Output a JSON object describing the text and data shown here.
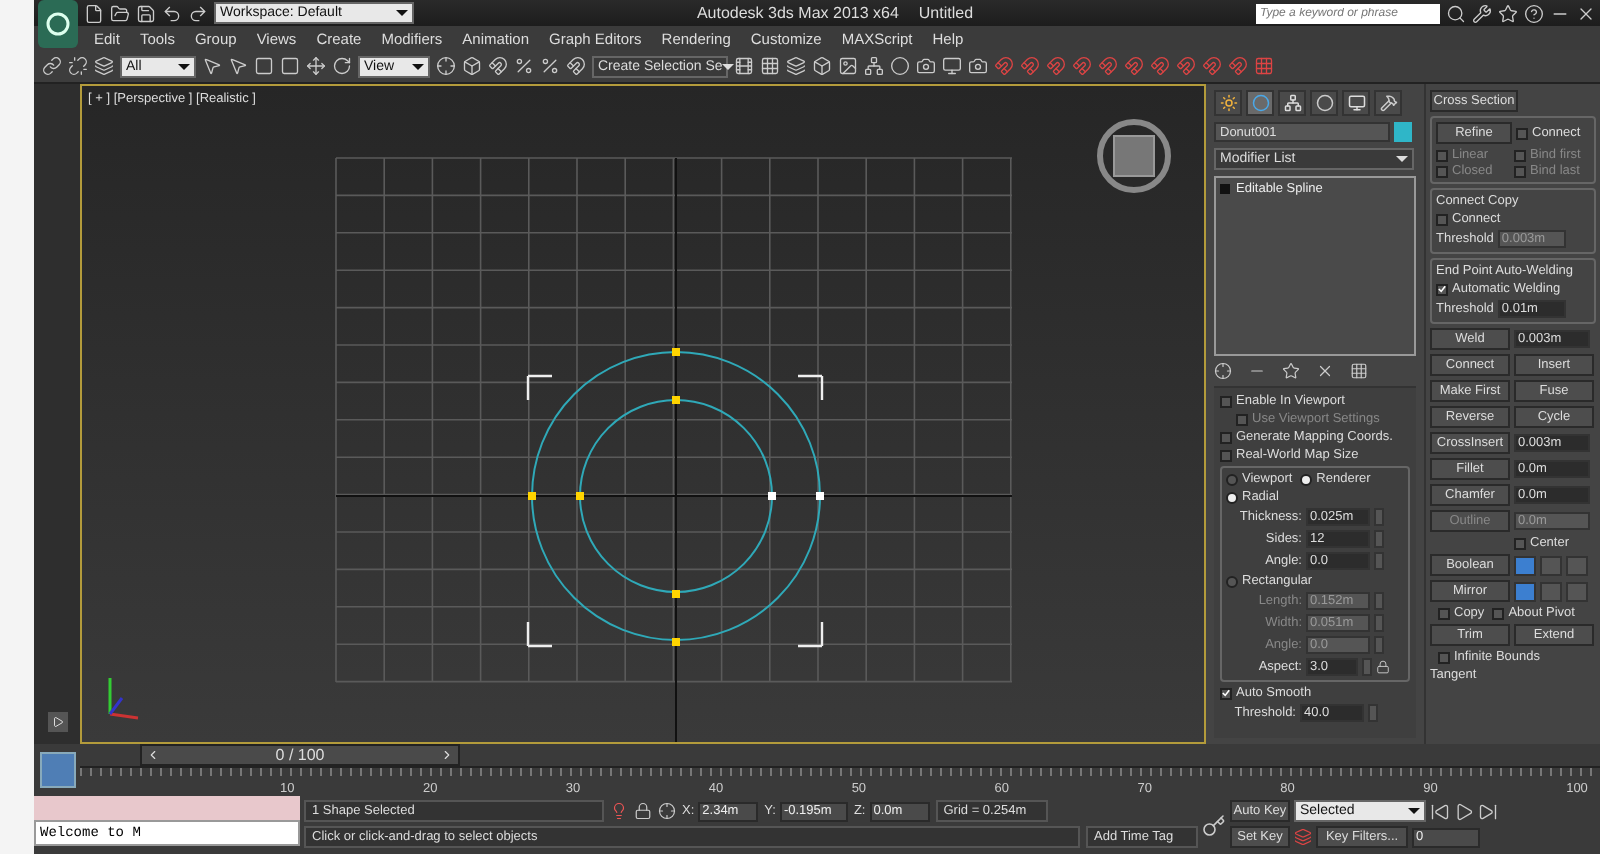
{
  "title_bar": {
    "workspace": "Workspace: Default",
    "title": "Autodesk 3ds Max  2013 x64",
    "document": "Untitled",
    "search_placeholder": "Type a keyword or phrase"
  },
  "menu": [
    "Edit",
    "Tools",
    "Group",
    "Views",
    "Create",
    "Modifiers",
    "Animation",
    "Graph Editors",
    "Rendering",
    "Customize",
    "MAXScript",
    "Help"
  ],
  "toolbar": {
    "selection_filter": "All",
    "reference_coord": "View",
    "named_selection": "Create Selection Se"
  },
  "viewport": {
    "label": "[ + ] [Perspective ] [Realistic ]"
  },
  "command_panel": {
    "tabs": [
      {
        "selected": false
      },
      {
        "selected": true
      },
      {
        "selected": false
      },
      {
        "selected": false
      },
      {
        "selected": false
      },
      {
        "selected": false
      }
    ],
    "object_name": "Donut001",
    "modifier_list": "Modifier List",
    "stack": [
      {
        "label": "Editable Spline"
      }
    ]
  },
  "rendering": {
    "checks": [
      {
        "label": "Enable In Viewport",
        "checked": false,
        "kind": "checkbox"
      },
      {
        "label": "Use Viewport Settings",
        "checked": false,
        "kind": "sub_checkbox"
      },
      {
        "label": "Generate Mapping Coords.",
        "checked": false,
        "kind": "checkbox"
      },
      {
        "label": "Real-World Map Size",
        "checked": false,
        "kind": "checkbox"
      }
    ],
    "mode": [
      {
        "label": "Viewport",
        "selected": false
      },
      {
        "label": "Renderer",
        "selected": true
      }
    ],
    "shapes": [
      {
        "label": "Radial",
        "selected": true,
        "fields": [
          {
            "label": "Thickness:",
            "value": "0.025m",
            "disabled": false,
            "kind": "spinner"
          },
          {
            "label": "Sides:",
            "value": "12",
            "disabled": false,
            "kind": "spinner"
          },
          {
            "label": "Angle:",
            "value": "0.0",
            "disabled": false,
            "kind": "spinner"
          }
        ]
      },
      {
        "label": "Rectangular",
        "selected": false,
        "fields": [
          {
            "label": "Length:",
            "value": "0.152m",
            "disabled": true,
            "kind": "spinner"
          },
          {
            "label": "Width:",
            "value": "0.051m",
            "disabled": true,
            "kind": "spinner"
          },
          {
            "label": "Angle:",
            "value": "0.0",
            "disabled": true,
            "kind": "spinner"
          },
          {
            "label": "Aspect:",
            "value": "3.0",
            "disabled": false,
            "kind": "spinner_lock"
          }
        ]
      }
    ],
    "auto_smooth": {
      "label": "Auto Smooth",
      "checked": true
    },
    "threshold": {
      "label": "Threshold:",
      "value": "40.0"
    }
  },
  "geometry": {
    "cross_section": "Cross Section",
    "refine": {
      "button": "Refine",
      "connect": {
        "label": "Connect",
        "checked": false
      },
      "options": [
        {
          "label": "Linear",
          "checked": false
        },
        {
          "label": "Bind first",
          "checked": false
        },
        {
          "label": "Closed",
          "checked": false
        },
        {
          "label": "Bind last",
          "checked": false
        }
      ]
    },
    "connect_copy": {
      "title": "Connect Copy",
      "check": {
        "label": "Connect",
        "checked": false
      },
      "threshold": {
        "label": "Threshold",
        "value": "0.003m",
        "disabled": true
      }
    },
    "auto_weld": {
      "title": "End Point Auto-Welding",
      "check": {
        "label": "Automatic Welding",
        "checked": true
      },
      "threshold": {
        "label": "Threshold",
        "value": "0.01m",
        "disabled": false
      }
    },
    "ops": [
      {
        "kind": "button_field",
        "button": "Weld",
        "value": "0.003m",
        "disabled": false
      },
      {
        "kind": "button_pair",
        "buttons": [
          "Connect",
          "Insert"
        ]
      },
      {
        "kind": "button_pair",
        "buttons": [
          "Make First",
          "Fuse"
        ]
      },
      {
        "kind": "button_pair",
        "buttons": [
          "Reverse",
          "Cycle"
        ]
      },
      {
        "kind": "button_field",
        "button": "CrossInsert",
        "value": "0.003m",
        "disabled": false
      },
      {
        "kind": "button_field",
        "button": "Fillet",
        "value": "0.0m",
        "disabled": false
      },
      {
        "kind": "button_field",
        "button": "Chamfer",
        "value": "0.0m",
        "disabled": false
      },
      {
        "kind": "button_field",
        "button": "Outline",
        "value": "0.0m",
        "disabled": true
      },
      {
        "kind": "checkbox_pair",
        "checks": [
          {
            "label": "Center",
            "checked": false
          }
        ]
      },
      {
        "kind": "button_icons",
        "button": "Boolean",
        "icons": [
          {
            "selected": true
          },
          {
            "selected": false
          },
          {
            "selected": false
          }
        ]
      },
      {
        "kind": "button_icons",
        "button": "Mirror",
        "icons": [
          {
            "selected": true
          },
          {
            "selected": false
          },
          {
            "selected": false
          }
        ]
      },
      {
        "kind": "checkbox_pair",
        "checks": [
          {
            "label": "Copy",
            "checked": false
          },
          {
            "label": "About Pivot",
            "checked": false
          }
        ]
      },
      {
        "kind": "button_pair",
        "buttons": [
          "Trim",
          "Extend"
        ]
      },
      {
        "kind": "checkbox_pair",
        "checks": [
          {
            "label": "Infinite Bounds",
            "checked": false
          }
        ]
      },
      {
        "kind": "group_title",
        "label": "Tangent"
      }
    ]
  },
  "timeline": {
    "frame": "0 / 100",
    "level": 0,
    "ticks": [
      "10",
      "20",
      "30",
      "40",
      "50",
      "60",
      "70",
      "80",
      "90",
      "100"
    ]
  },
  "status_bar": {
    "console": "Welcome to M",
    "selection": "1 Shape Selected",
    "prompt": "Click or click-and-drag to select objects",
    "coords": [
      {
        "label": "X:",
        "value": "2.34m"
      },
      {
        "label": "Y:",
        "value": "-0.195m"
      },
      {
        "label": "Z:",
        "value": "0.0m"
      }
    ],
    "grid": "Grid = 0.254m",
    "add_time_tag": "Add Time Tag",
    "auto_key": "Auto Key",
    "set_key": "Set Key",
    "key_mode": "Selected",
    "key_filters": "Key Filters...",
    "frame": "0"
  }
}
